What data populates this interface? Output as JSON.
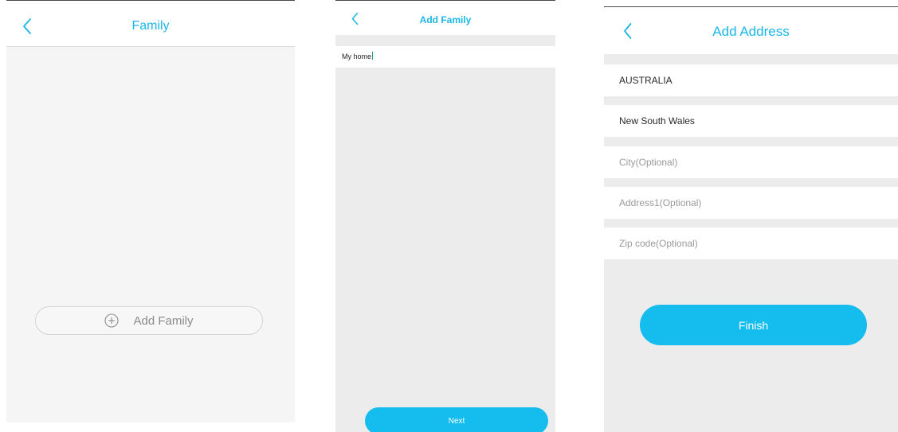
{
  "family_screen": {
    "title": "Family",
    "add_family_label": "Add Family"
  },
  "add_family_screen": {
    "title": "Add Family",
    "family_name_value": "My home",
    "next_label": "Next"
  },
  "add_address_screen": {
    "title": "Add Address",
    "country_value": "AUSTRALIA",
    "state_value": "New South Wales",
    "city_placeholder": "City(Optional)",
    "address1_placeholder": "Address1(Optional)",
    "zip_placeholder": "Zip code(Optional)",
    "finish_label": "Finish"
  },
  "colors": {
    "accent": "#14bdee",
    "title_blue": "#1ab7e6",
    "background_gray": "#ececec"
  },
  "icons": {
    "back": "chevron-left-icon",
    "add": "plus-circle-icon"
  }
}
